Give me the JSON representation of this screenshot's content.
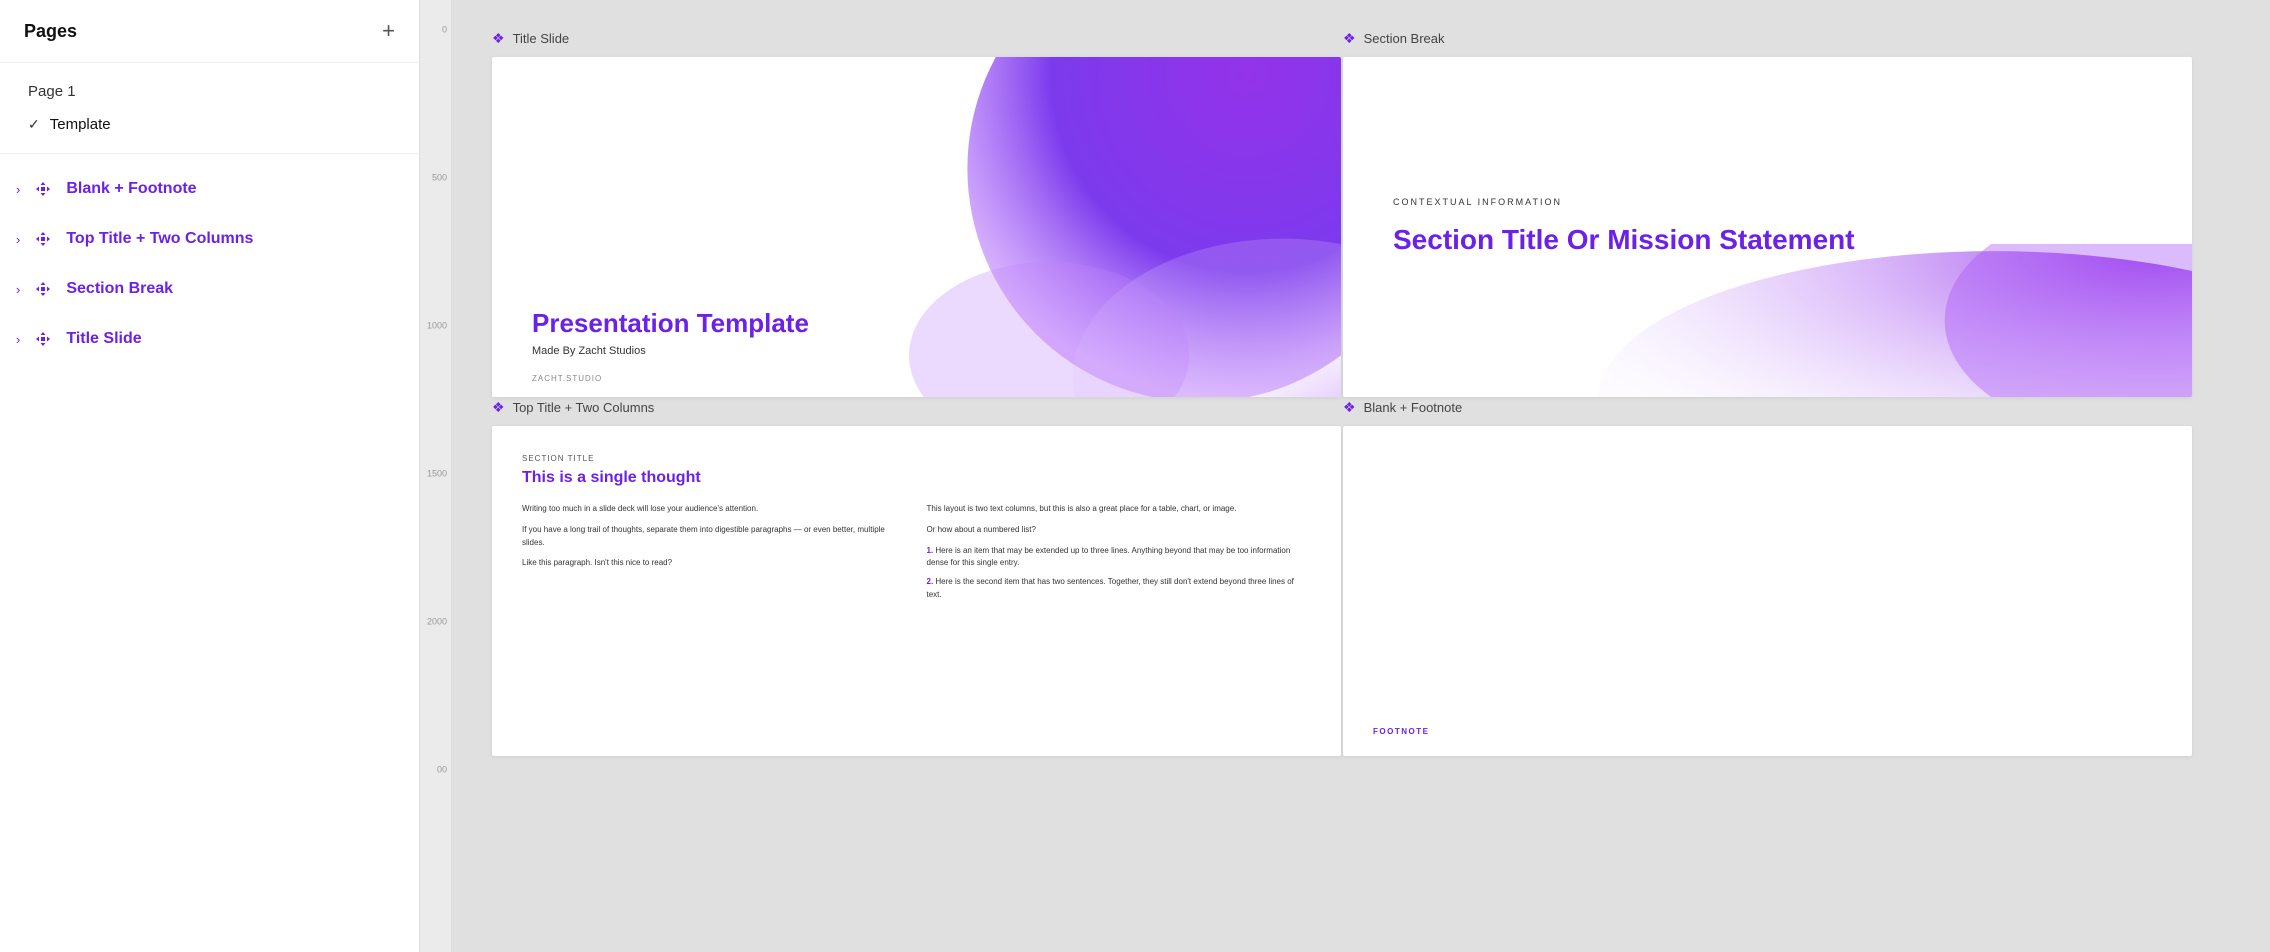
{
  "sidebar": {
    "title": "Pages",
    "add_label": "+",
    "pages": [
      {
        "id": "page1",
        "label": "Page 1",
        "active": false,
        "check": false
      },
      {
        "id": "template",
        "label": "Template",
        "active": true,
        "check": true
      }
    ],
    "layouts": [
      {
        "id": "blank-footnote",
        "label": "Blank + Footnote"
      },
      {
        "id": "top-title-two-col",
        "label": "Top Title + Two Columns"
      },
      {
        "id": "section-break",
        "label": "Section Break"
      },
      {
        "id": "title-slide",
        "label": "Title Slide"
      }
    ]
  },
  "canvas": {
    "slides": [
      {
        "id": "title-slide",
        "label": "Title Slide",
        "type": "title",
        "content": {
          "title": "Presentation Template",
          "subtitle": "Made By Zacht Studios",
          "watermark": "ZACHT.STUDIO"
        }
      },
      {
        "id": "section-break",
        "label": "Section Break",
        "type": "section-break",
        "content": {
          "contextual": "CONTEXTUAL INFORMATION",
          "heading": "Section Title Or Mission Statement"
        }
      },
      {
        "id": "top-title-two-col",
        "label": "Top Title + Two Columns",
        "type": "two-col",
        "content": {
          "section_label": "Section Title",
          "heading": "This is a single thought",
          "col1": [
            "Writing too much in a slide deck will lose your audience's attention.",
            "If you have a long trail of thoughts, separate them into digestible paragraphs — or even better, multiple slides.",
            "Like this paragraph. Isn't this nice to read?"
          ],
          "col2_intro": "This layout is two text columns, but this is also a great place for a table, chart, or image.",
          "col2_list_intro": "Or how about a numbered list?",
          "col2_items": [
            {
              "num": "1.",
              "text": "Here is an item that may be extended up to three lines. Anything beyond that may be too information dense for this single entry."
            },
            {
              "num": "2.",
              "text": "Here is the second item that has two sentences. Together, they still don't extend beyond three lines of text."
            }
          ]
        }
      },
      {
        "id": "blank-footnote",
        "label": "Blank + Footnote",
        "type": "blank-footnote",
        "content": {
          "footnote": "FOOTNOTE"
        }
      }
    ],
    "ruler_marks": [
      "0",
      "500",
      "1000",
      "1500",
      "2000",
      "00"
    ]
  },
  "icons": {
    "diamond": "❖",
    "checkmark": "✓",
    "arrow_right": "›"
  }
}
